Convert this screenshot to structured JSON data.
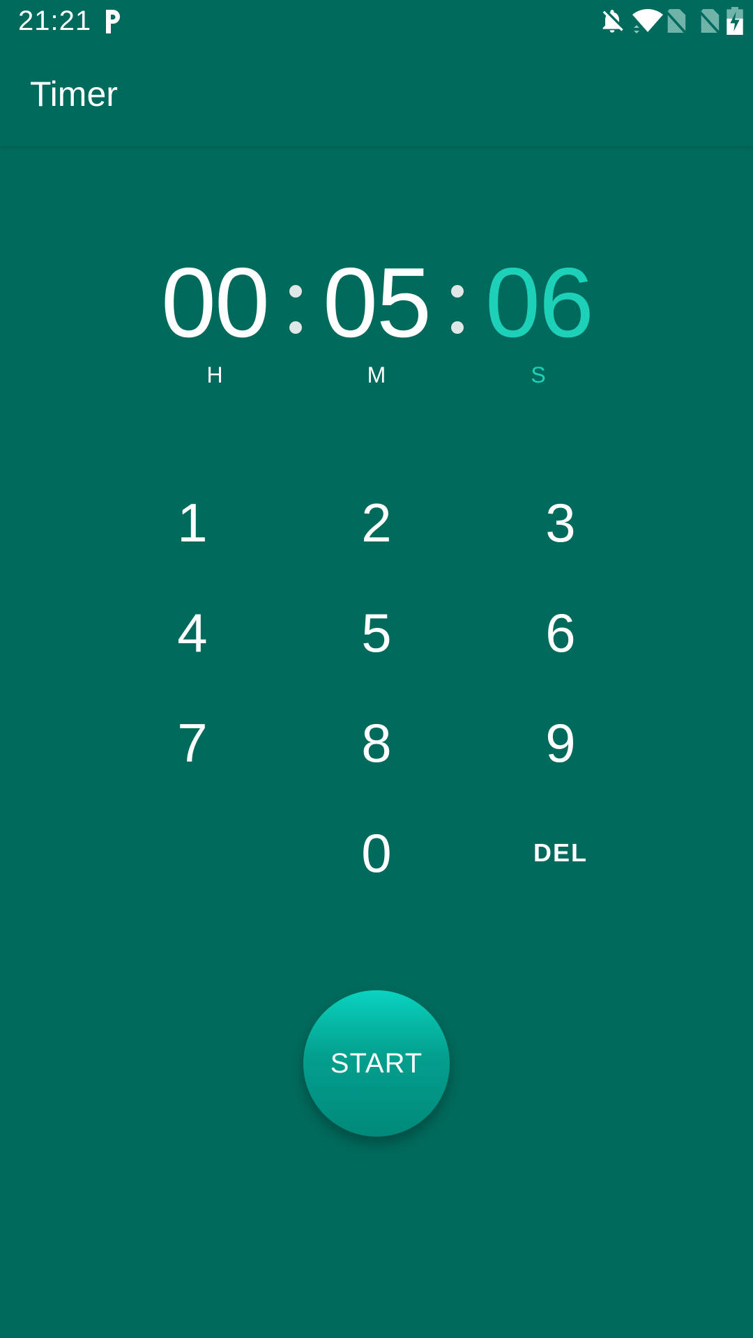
{
  "status_bar": {
    "time": "21:21",
    "app_icon": "parking-p-icon",
    "icons": [
      "notifications-off-icon",
      "wifi-icon",
      "no-sim-icon",
      "no-sim-icon",
      "battery-charging-icon"
    ]
  },
  "app_bar": {
    "title": "Timer"
  },
  "timer": {
    "hours": "00",
    "minutes": "05",
    "seconds": "06",
    "hours_label": "H",
    "minutes_label": "M",
    "seconds_label": "S",
    "active_field": "seconds"
  },
  "keypad": {
    "keys": [
      "1",
      "2",
      "3",
      "4",
      "5",
      "6",
      "7",
      "8",
      "9",
      "0"
    ],
    "delete_label": "DEL"
  },
  "start_button": {
    "label": "START"
  },
  "colors": {
    "background": "#006a5c",
    "accent": "#1dd1b9",
    "button_top": "#09d3bf",
    "button_bottom": "#00897b"
  }
}
